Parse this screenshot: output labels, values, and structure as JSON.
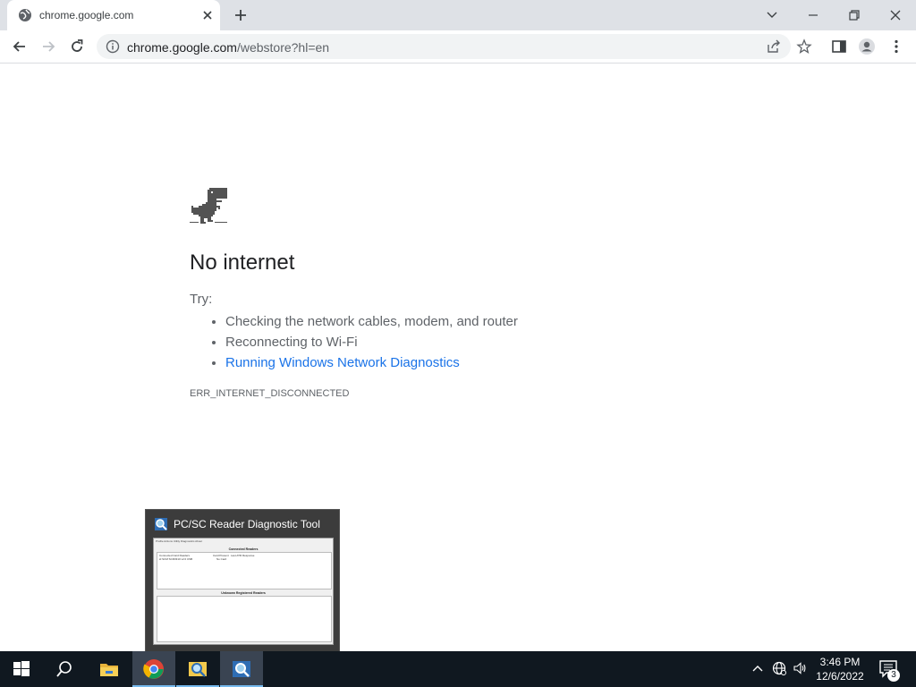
{
  "browser": {
    "tab": {
      "title": "chrome.google.com",
      "favicon": "globe-icon"
    },
    "window_controls": [
      "chevron-down-icon",
      "minimize-icon",
      "restore-icon",
      "close-icon"
    ],
    "toolbar": {
      "back": "back-arrow-icon",
      "forward": "forward-arrow-icon",
      "reload": "reload-icon"
    },
    "omnibox": {
      "host": "chrome.google.com",
      "path": "/webstore?hl=en",
      "icons": [
        "info-icon",
        "share-icon",
        "star-icon"
      ]
    },
    "toolbar_right": [
      "side-panel-icon",
      "profile-icon",
      "more-menu-icon"
    ]
  },
  "error_page": {
    "title": "No internet",
    "try_label": "Try:",
    "suggestions": [
      "Checking the network cables, modem, and router",
      "Reconnecting to Wi-Fi"
    ],
    "diagnostics_link": "Running Windows Network Diagnostics",
    "error_code": "ERR_INTERNET_DISCONNECTED",
    "link_color": "#1a73e8"
  },
  "thumbnail": {
    "title": "PC/SC Reader Diagnostic Tool",
    "preview": {
      "menu": "Profile  Actions  Utility  Diagnostics  About",
      "section1": "Connected Readers",
      "col_reader": "Connected Card Readers",
      "col_reader_value": "id SCM SCR3310 v2.0 USB",
      "col_card": "Card Present",
      "col_card_value": "No Card",
      "col_last": "Last ATR Response",
      "section2": "Unknown Registered Readers"
    }
  },
  "taskbar": {
    "apps": [
      "start-icon",
      "search-icon",
      "file-explorer-icon",
      "chrome-icon",
      "diagnostic-tool-icon",
      "reader-tool-icon"
    ],
    "tray": [
      "chevron-up-icon",
      "network-globe-icon",
      "volume-icon"
    ],
    "time": "3:46 PM",
    "date": "12/6/2022",
    "notification_count": "3",
    "accent": "#76b9ed"
  }
}
